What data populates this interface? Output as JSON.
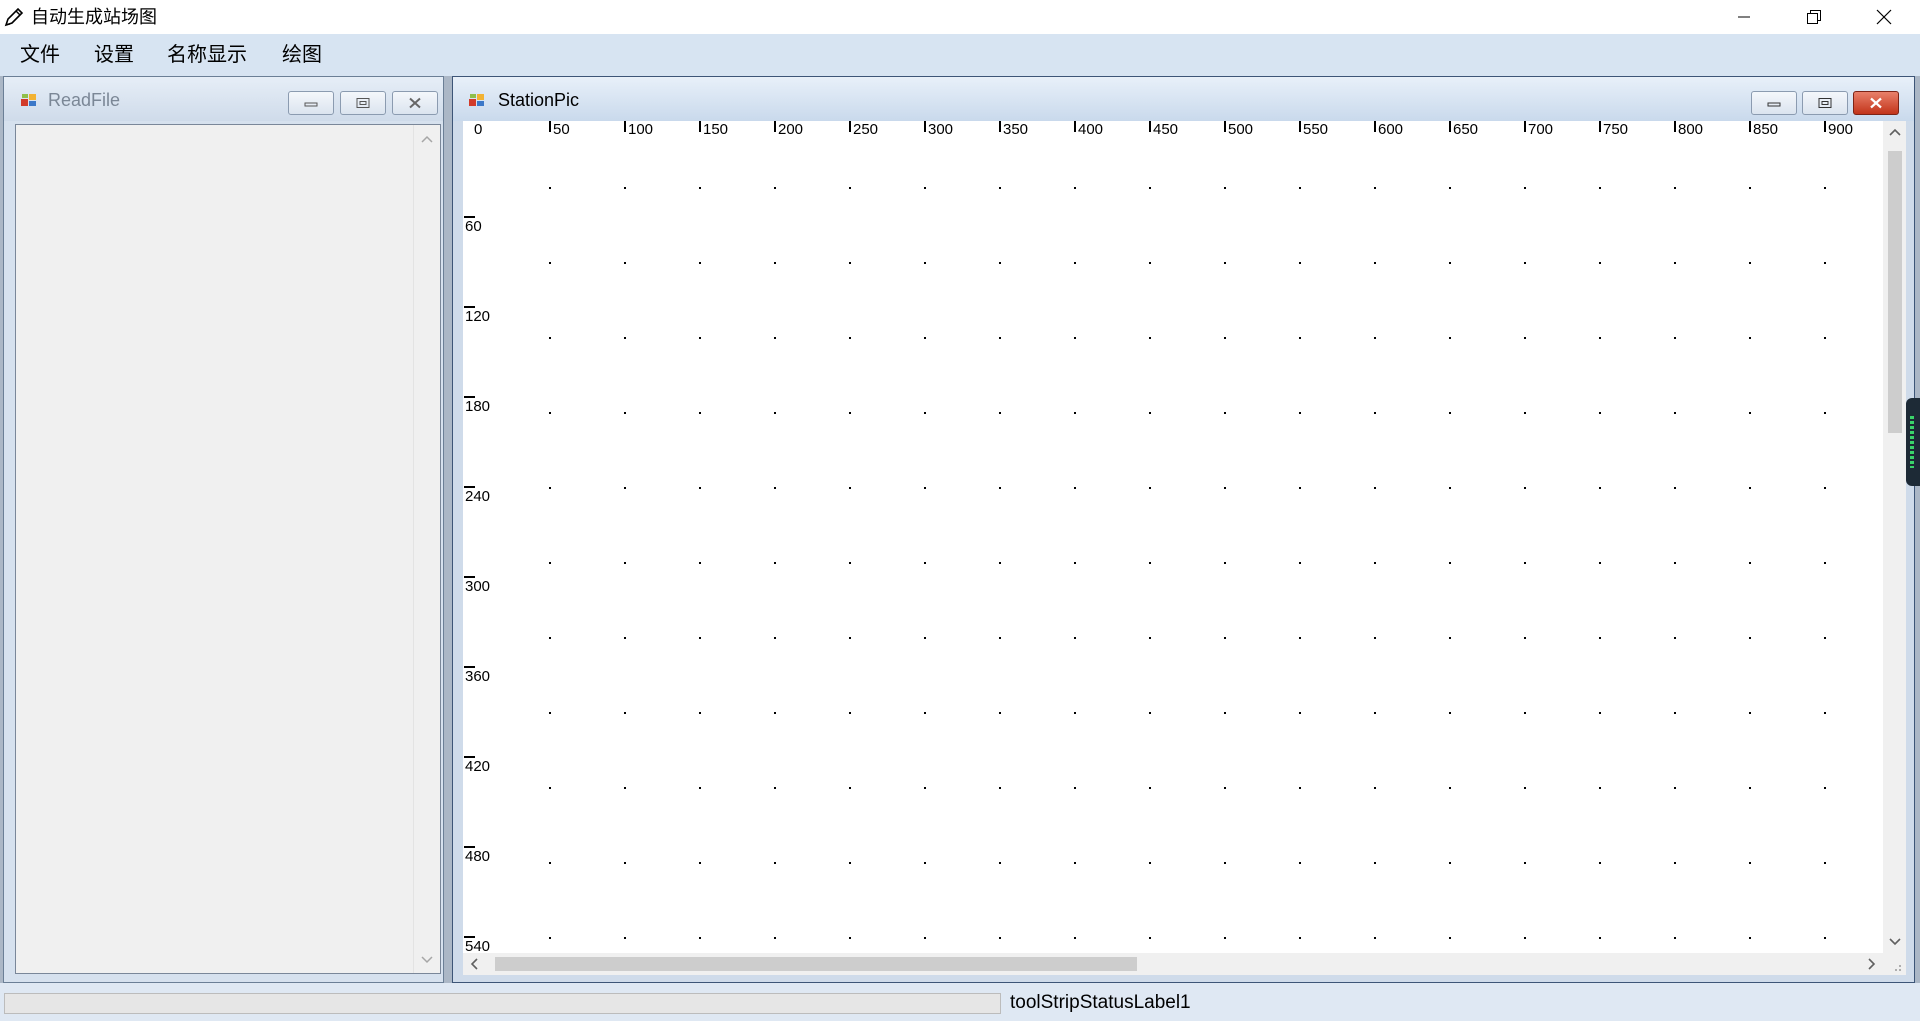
{
  "window": {
    "title": "自动生成站场图",
    "icon": "pencil-icon"
  },
  "menu": [
    "文件",
    "设置",
    "名称显示",
    "绘图"
  ],
  "readfile_window": {
    "title": "ReadFile",
    "icon": "app-window-icon"
  },
  "stationpic_window": {
    "title": "StationPic",
    "icon": "app-window-icon",
    "x_ticks": [
      "0",
      "50",
      "100",
      "150",
      "200",
      "250",
      "300",
      "350",
      "400",
      "450",
      "500",
      "550",
      "600",
      "650",
      "700",
      "750",
      "800",
      "850",
      "900"
    ],
    "y_ticks": [
      "60",
      "120",
      "180",
      "240",
      "300",
      "360",
      "420",
      "480",
      "540"
    ]
  },
  "statusbar": {
    "label": "toolStripStatusLabel1"
  },
  "colors": {
    "menubar": "#d7e4f2",
    "mdi_background": "#abb7c6",
    "close_active": "#c2341a"
  }
}
